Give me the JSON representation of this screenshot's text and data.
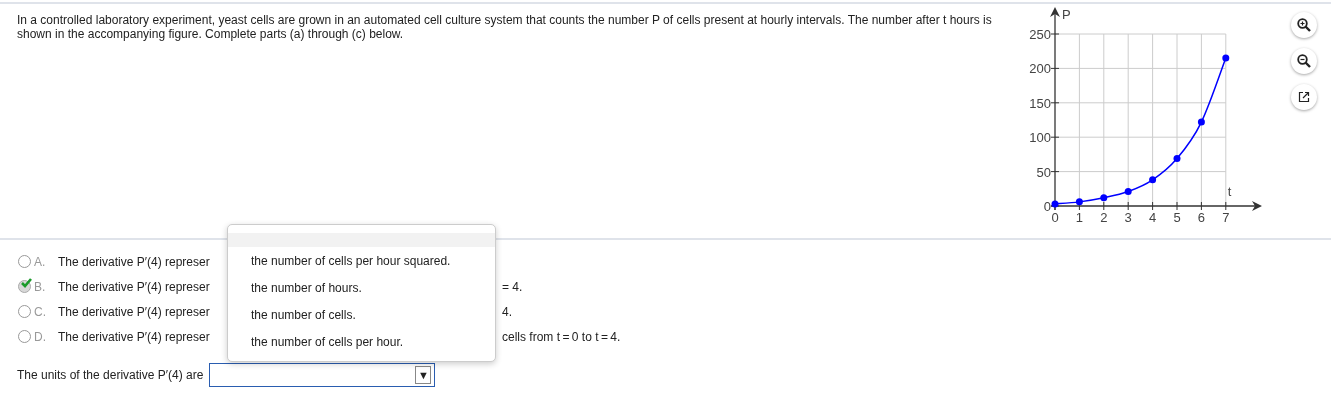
{
  "question": "In a controlled laboratory experiment, yeast cells are grown in an automated cell culture system that counts the number P of cells present at hourly intervals. The number after t hours is shown in the accompanying figure. Complete parts (a) through (c) below.",
  "figure": {
    "chart_data": {
      "type": "line",
      "xlabel": "t",
      "ylabel": "P",
      "x": [
        0,
        1,
        2,
        3,
        4,
        5,
        6,
        7
      ],
      "series": [
        {
          "color": "#0000ff",
          "marker": "circle",
          "values": [
            3,
            6,
            12,
            21,
            38,
            69,
            122,
            215
          ]
        }
      ],
      "grid": true,
      "xlim": [
        0,
        7
      ],
      "ylim": [
        0,
        250
      ],
      "xticks": [
        0,
        1,
        2,
        3,
        4,
        5,
        6,
        7
      ],
      "yticks": [
        0,
        50,
        100,
        150,
        200,
        250
      ]
    }
  },
  "options": [
    {
      "letter": "A.",
      "text": "The derivative P′(4) represer",
      "selected": false,
      "marked_correct": false
    },
    {
      "letter": "B.",
      "text": "The derivative P′(4) represer",
      "tail": "= 4.",
      "selected": true,
      "marked_correct": true
    },
    {
      "letter": "C.",
      "text": "The derivative P′(4) represer",
      "tail": "4.",
      "selected": false,
      "marked_correct": false
    },
    {
      "letter": "D.",
      "text": "The derivative P′(4) represer",
      "tail": "cells from t = 0 to t = 4.",
      "selected": false,
      "marked_correct": false
    }
  ],
  "units_prompt": "The units of the derivative P′(4) are",
  "units_select": {
    "arrow": "▼",
    "expanded": true
  },
  "menu_items": [
    "the number of cells per hour squared.",
    "the number of hours.",
    "the number of cells.",
    "the number of cells per hour."
  ]
}
